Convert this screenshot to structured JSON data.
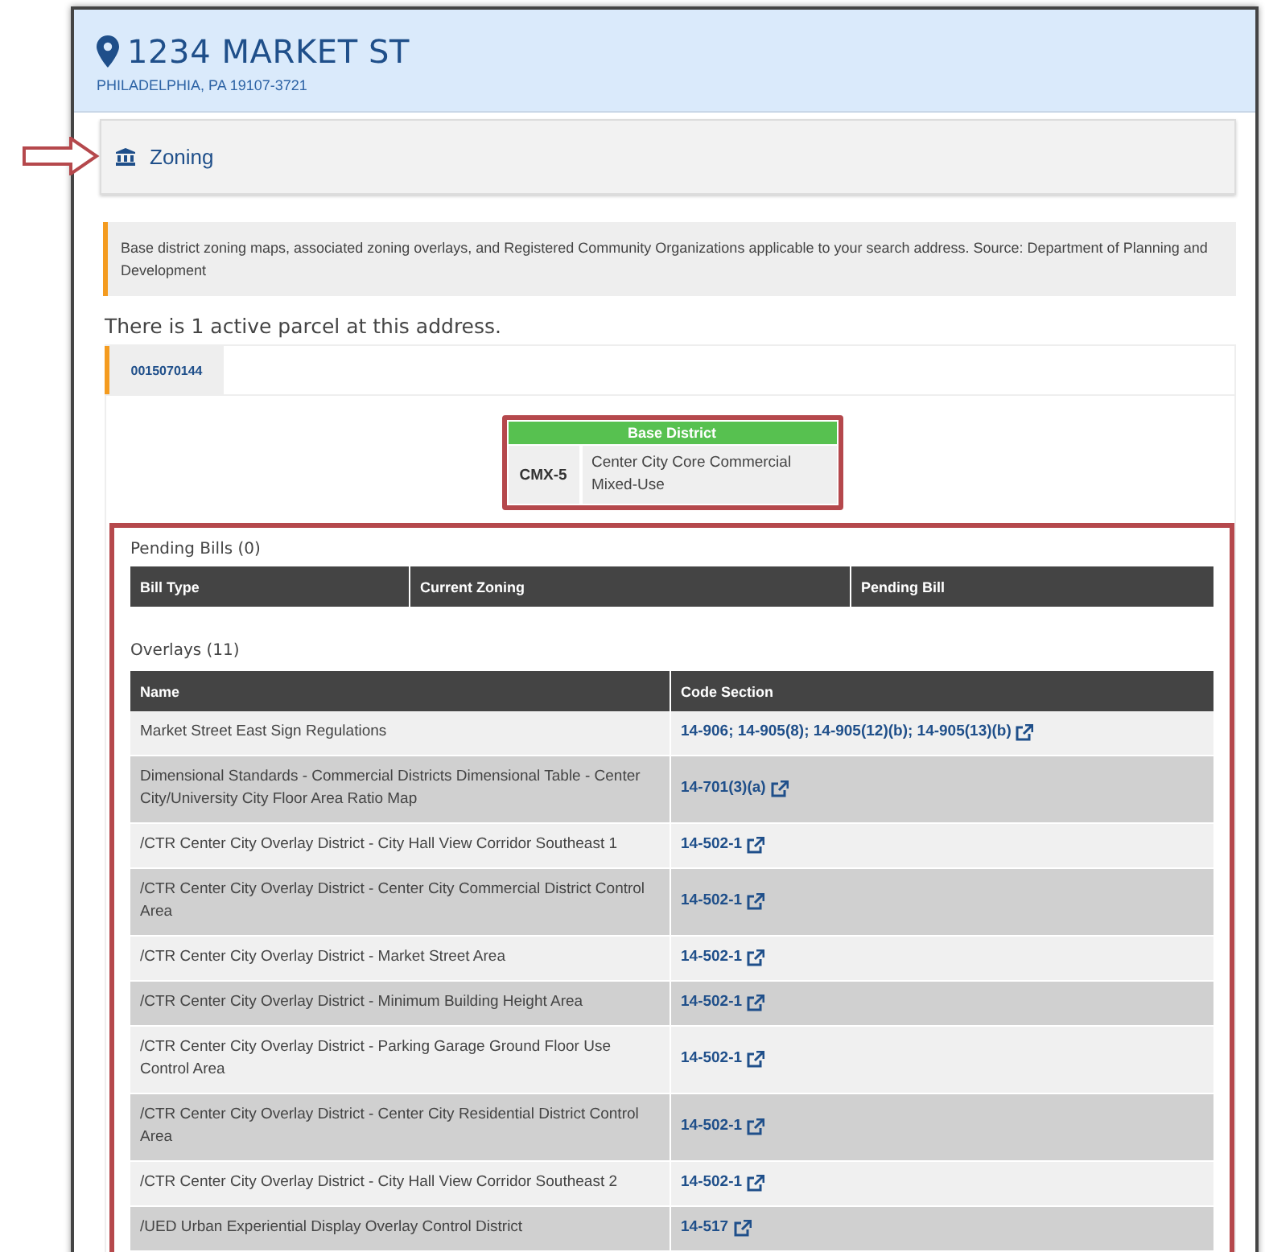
{
  "header": {
    "title": "1234 MARKET ST",
    "subtitle": "PHILADELPHIA, PA 19107-3721"
  },
  "section": {
    "title": "Zoning"
  },
  "description": "Base district zoning maps, associated zoning overlays, and Registered Community Organizations applicable to your search address. Source: Department of Planning and Development",
  "parcel_count_text": "There is 1 active parcel at this address.",
  "parcel_tabs": [
    {
      "label": "0015070144",
      "selected": true
    }
  ],
  "base_district": {
    "heading": "Base District",
    "code": "CMX-5",
    "description": "Center City Core Commercial Mixed-Use"
  },
  "pending_bills": {
    "title": "Pending Bills (0)",
    "columns": [
      "Bill Type",
      "Current Zoning",
      "Pending Bill"
    ]
  },
  "overlays": {
    "title": "Overlays (11)",
    "columns": [
      "Name",
      "Code Section"
    ],
    "rows": [
      {
        "name": "Market Street East Sign Regulations",
        "code_section": "14-906; 14-905(8); 14-905(12)(b); 14-905(13)(b)"
      },
      {
        "name": "Dimensional Standards - Commercial Districts Dimensional Table - Center City/University City Floor Area Ratio Map",
        "code_section": "14-701(3)(a)"
      },
      {
        "name": "/CTR Center City Overlay District - City Hall View Corridor Southeast 1",
        "code_section": "14-502-1"
      },
      {
        "name": "/CTR Center City Overlay District - Center City Commercial District Control Area",
        "code_section": "14-502-1"
      },
      {
        "name": "/CTR Center City Overlay District - Market Street Area",
        "code_section": "14-502-1"
      },
      {
        "name": "/CTR Center City Overlay District - Minimum Building Height Area",
        "code_section": "14-502-1"
      },
      {
        "name": "/CTR Center City Overlay District - Parking Garage Ground Floor Use Control Area",
        "code_section": "14-502-1"
      },
      {
        "name": "/CTR Center City Overlay District - Center City Residential District Control Area",
        "code_section": "14-502-1"
      },
      {
        "name": "/CTR Center City Overlay District - City Hall View Corridor Southeast 2",
        "code_section": "14-502-1"
      },
      {
        "name": "/UED Urban Experiential Display Overlay Control District",
        "code_section": "14-517"
      }
    ]
  }
}
